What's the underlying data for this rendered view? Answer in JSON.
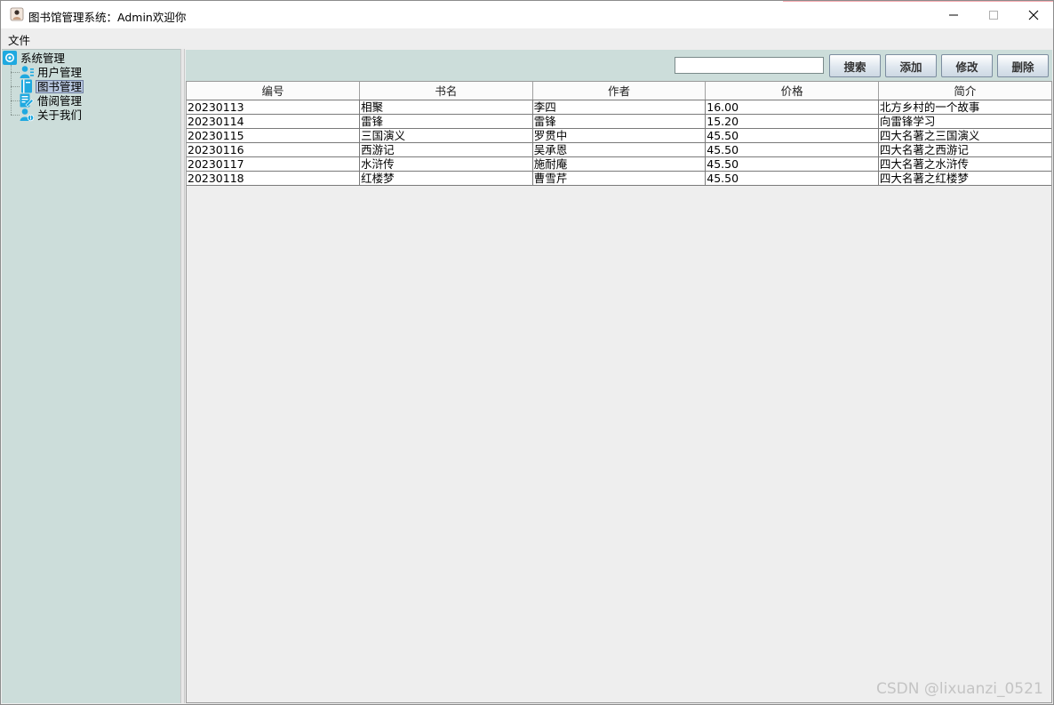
{
  "window": {
    "title": "图书馆管理系统：Admin欢迎你"
  },
  "menu": {
    "file": "文件"
  },
  "tree": {
    "root": "系统管理",
    "items": [
      {
        "label": "用户管理",
        "icon": "user-icon"
      },
      {
        "label": "图书管理",
        "icon": "book-icon",
        "selected": true
      },
      {
        "label": "借阅管理",
        "icon": "borrow-icon"
      },
      {
        "label": "关于我们",
        "icon": "about-icon"
      }
    ]
  },
  "toolbar": {
    "search_value": "",
    "search_label": "搜索",
    "add_label": "添加",
    "edit_label": "修改",
    "delete_label": "删除"
  },
  "table": {
    "columns": [
      "编号",
      "书名",
      "作者",
      "价格",
      "简介"
    ],
    "rows": [
      [
        "20230113",
        "相聚",
        "李四",
        "16.00",
        "北方乡村的一个故事"
      ],
      [
        "20230114",
        "雷锋",
        "雷锋",
        "15.20",
        "向雷锋学习"
      ],
      [
        "20230115",
        "三国演义",
        "罗贯中",
        "45.50",
        "四大名著之三国演义"
      ],
      [
        "20230116",
        "西游记",
        "吴承恩",
        "45.50",
        "四大名著之西游记"
      ],
      [
        "20230117",
        "水浒传",
        "施耐庵",
        "45.50",
        "四大名著之水浒传"
      ],
      [
        "20230118",
        "红楼梦",
        "曹雪芹",
        "45.50",
        "四大名著之红楼梦"
      ]
    ]
  },
  "watermark": "CSDN @lixuanzi_0521",
  "colors": {
    "panel": "#ccddda",
    "accent": "#1fa9e0"
  }
}
